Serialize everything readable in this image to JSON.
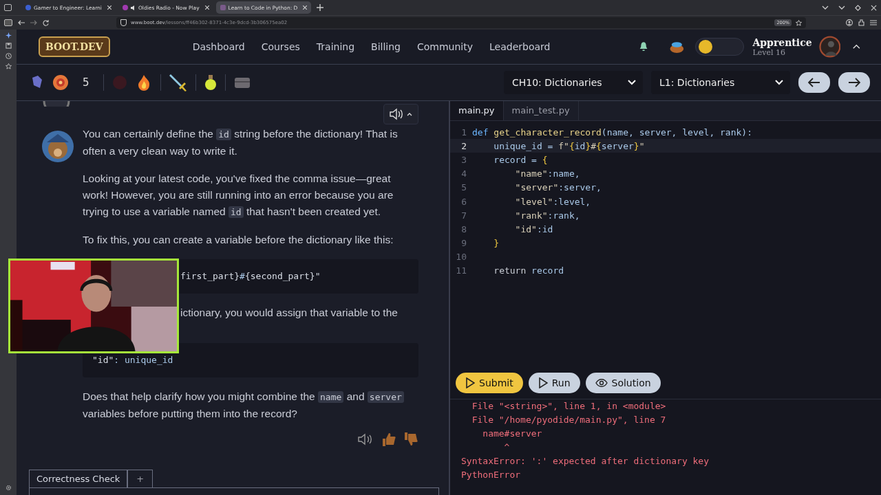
{
  "browser": {
    "tabs": [
      {
        "label": "Gamer to Engineer: Learni",
        "selected": false,
        "kind": "r"
      },
      {
        "label": "Oldies Radio - Now Play",
        "selected": false,
        "kind": "audio"
      },
      {
        "label": "Learn to Code in Python: D",
        "selected": true,
        "kind": "page"
      }
    ],
    "address": {
      "host": "www.boot.dev",
      "path": "/lessons/ff46b302-8371-4c3e-9dcd-3b306575ea02"
    },
    "zoom": "200%"
  },
  "nav": {
    "logo": "BOOT.DEV",
    "links": [
      "Dashboard",
      "Courses",
      "Training",
      "Billing",
      "Community",
      "Leaderboard"
    ],
    "coin_switch": {
      "on": false
    },
    "rank": "Apprentice",
    "level": "Level 16"
  },
  "toolbar": {
    "streak": "5",
    "chapter": "CH10: Dictionaries",
    "lesson": "L1: Dictionaries"
  },
  "chat": {
    "paragraphs": [
      {
        "kind": "text",
        "parts": [
          {
            "text": "You can certainly define the ",
            "kind": "text"
          },
          {
            "text": "id",
            "kind": "code"
          },
          {
            "text": " string before the dictionary! That is often a very clean way to write it.",
            "kind": "text"
          }
        ]
      },
      {
        "kind": "text",
        "parts": [
          {
            "text": "Looking at your latest code, you've fixed the comma issue—great work! However, you are still running into an error because you are trying to use a variable named ",
            "kind": "text"
          },
          {
            "text": "id",
            "kind": "code"
          },
          {
            "text": " that hasn't been created yet.",
            "kind": "text"
          }
        ]
      },
      {
        "kind": "text",
        "parts": [
          {
            "text": "To fix this, you can create a variable before the dictionary like this:",
            "kind": "text"
          }
        ]
      },
      {
        "kind": "hidden-code",
        "parts": [
          {
            "text": "first_part}",
            "kind": "text"
          },
          {
            "text": "#",
            "kind": "code"
          },
          {
            "text": "{second_part}\"",
            "kind": "text"
          }
        ]
      },
      {
        "kind": "hidden-text",
        "parts": [
          {
            "text": "ictionary, you would assign that variable to the",
            "kind": "text"
          }
        ]
      },
      {
        "kind": "code",
        "parts": [
          {
            "text": "\"id\"",
            "kind": "text"
          },
          {
            "text": ": unique_id",
            "kind": "code"
          }
        ]
      },
      {
        "kind": "text",
        "parts": [
          {
            "text": "Does that help clarify how you might combine the ",
            "kind": "text"
          },
          {
            "text": "name",
            "kind": "code"
          },
          {
            "text": " and ",
            "kind": "text"
          },
          {
            "text": "server",
            "kind": "code"
          },
          {
            "text": " variables before putting them into the record?",
            "kind": "text"
          }
        ]
      }
    ]
  },
  "editor": {
    "tabs": [
      {
        "label": "main.py",
        "selected": true
      },
      {
        "label": "main_test.py",
        "selected": false
      }
    ],
    "lines": [
      {
        "number": "1",
        "selected": false,
        "tokens": [
          {
            "kind": "kw",
            "text": "def "
          },
          {
            "kind": "fn",
            "text": "get_character_record"
          },
          {
            "kind": "plain",
            "text": "(name, server, level, rank):"
          }
        ]
      },
      {
        "number": "2",
        "selected": true,
        "tokens": [
          {
            "kind": "plain",
            "text": "    unique_id = "
          },
          {
            "kind": "str",
            "text": "f\""
          },
          {
            "kind": "brace",
            "text": "{"
          },
          {
            "kind": "plain",
            "text": "id"
          },
          {
            "kind": "brace",
            "text": "}"
          },
          {
            "kind": "str",
            "text": "#"
          },
          {
            "kind": "brace",
            "text": "{"
          },
          {
            "kind": "plain",
            "text": "server"
          },
          {
            "kind": "brace",
            "text": "}"
          },
          {
            "kind": "str",
            "text": "\""
          }
        ]
      },
      {
        "number": "3",
        "selected": false,
        "tokens": [
          {
            "kind": "plain",
            "text": "    record = "
          },
          {
            "kind": "brace",
            "text": "{"
          }
        ]
      },
      {
        "number": "4",
        "selected": false,
        "tokens": [
          {
            "kind": "str",
            "text": "        \"name\""
          },
          {
            "kind": "plain",
            "text": ":name,"
          }
        ]
      },
      {
        "number": "5",
        "selected": false,
        "tokens": [
          {
            "kind": "str",
            "text": "        \"server\""
          },
          {
            "kind": "plain",
            "text": ":server,"
          }
        ]
      },
      {
        "number": "6",
        "selected": false,
        "tokens": [
          {
            "kind": "str",
            "text": "        \"level\""
          },
          {
            "kind": "plain",
            "text": ":level,"
          }
        ]
      },
      {
        "number": "7",
        "selected": false,
        "tokens": [
          {
            "kind": "str",
            "text": "        \"rank\""
          },
          {
            "kind": "plain",
            "text": ":rank,"
          }
        ]
      },
      {
        "number": "8",
        "selected": false,
        "tokens": [
          {
            "kind": "str",
            "text": "        \"id\""
          },
          {
            "kind": "plain",
            "text": ":id"
          }
        ]
      },
      {
        "number": "9",
        "selected": false,
        "tokens": [
          {
            "kind": "brace",
            "text": "    }"
          }
        ]
      },
      {
        "number": "10",
        "selected": false
      },
      {
        "number": "11",
        "selected": false,
        "tokens": [
          {
            "kind": "kw2",
            "text": "    return "
          },
          {
            "kind": "plain",
            "text": "record"
          }
        ]
      }
    ],
    "buttons": [
      {
        "label": "Submit",
        "kind": "submit"
      },
      {
        "label": "Run",
        "kind": "run"
      },
      {
        "label": "Solution",
        "kind": "solution"
      }
    ],
    "output": [
      "  File \"<string>\", line 1, in <module>",
      "  File \"/home/pyodide/main.py\", line 7",
      "    name#server",
      "        ^",
      "SyntaxError: ':' expected after dictionary key",
      "PythonError"
    ]
  },
  "bottom_tabs": [
    {
      "label": "Correctness Check",
      "selected": true
    },
    {
      "label": "+",
      "selected": false
    }
  ]
}
